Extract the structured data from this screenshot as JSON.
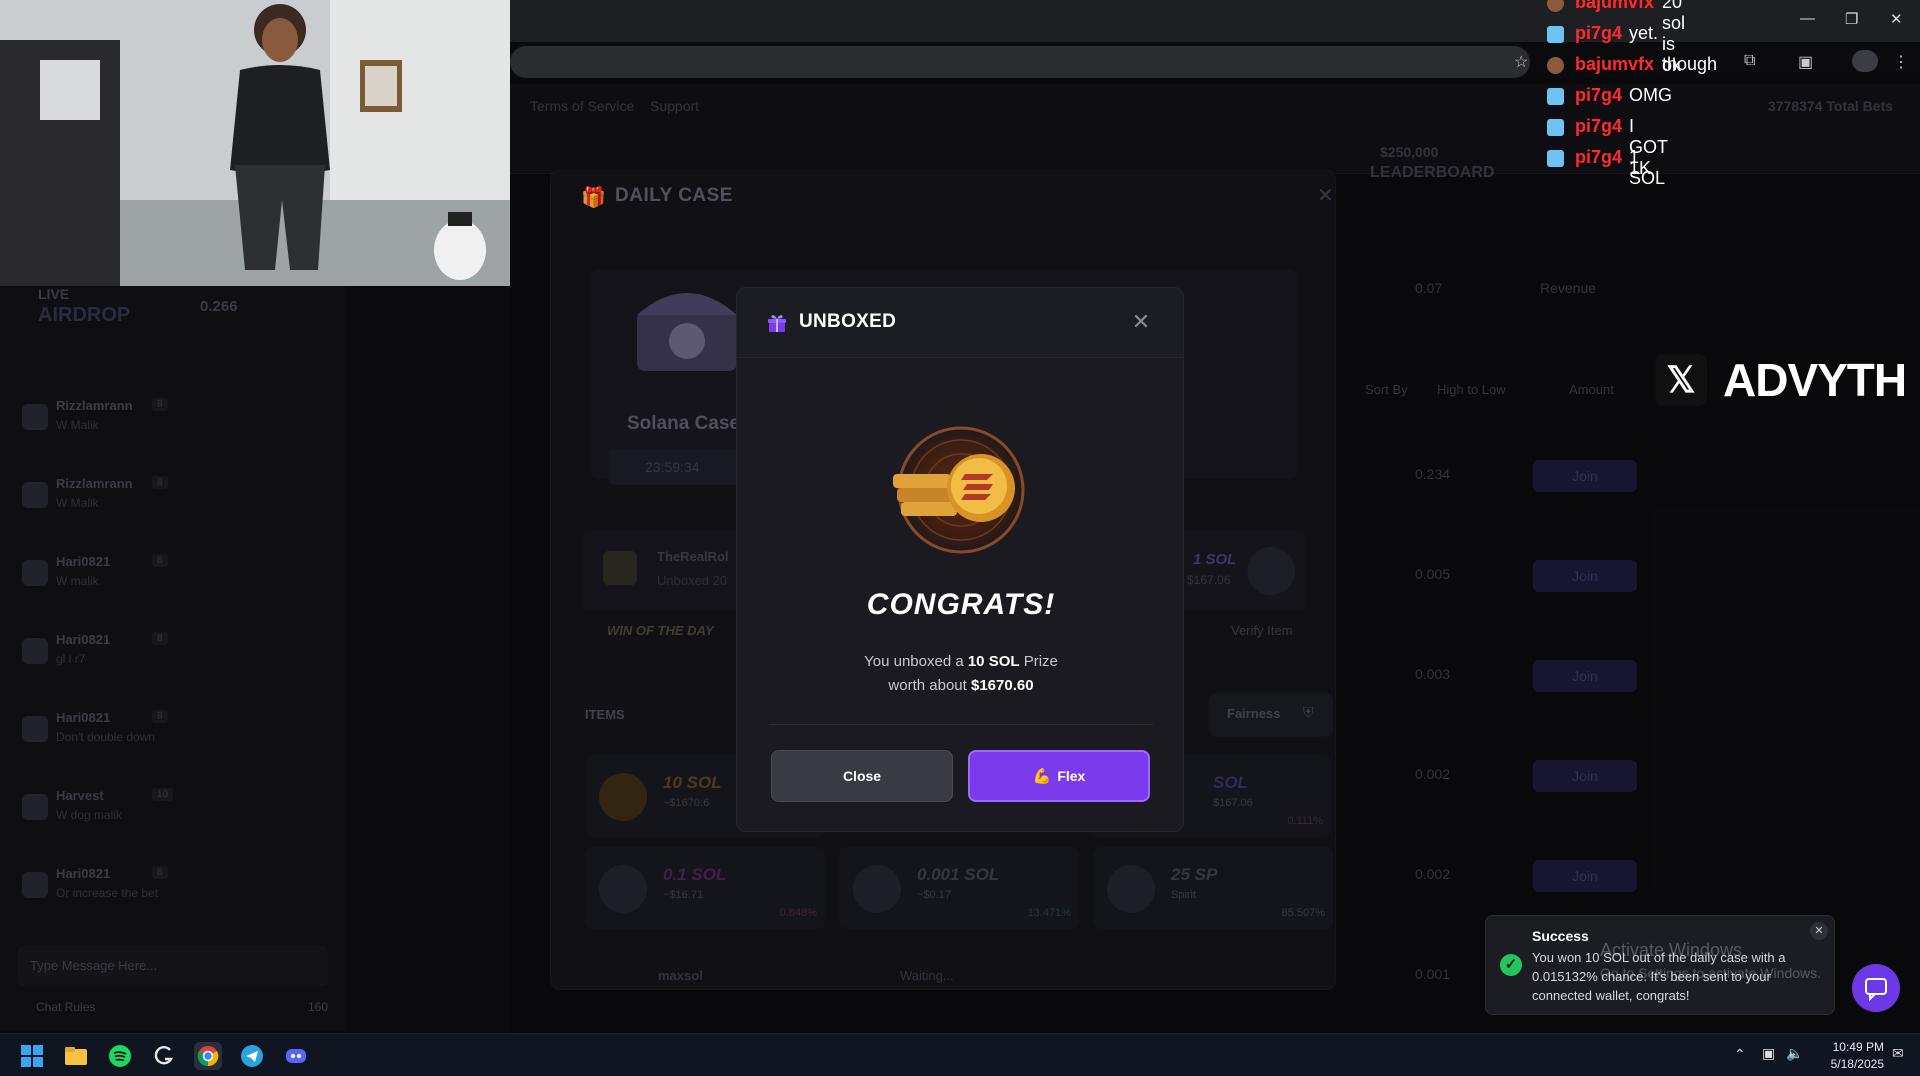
{
  "stream_chat": [
    {
      "name": "bajumvfx",
      "message": "20 sol is ok"
    },
    {
      "name": "pi7g4",
      "message": "yet."
    },
    {
      "name": "bajumvfx",
      "message": "though"
    },
    {
      "name": "pi7g4",
      "message": "OMG"
    },
    {
      "name": "pi7g4",
      "message": "I GOT 1K"
    },
    {
      "name": "pi7g4",
      "message": "1 SOL"
    }
  ],
  "overlay_brand": "ADVYTH",
  "site": {
    "nav": [
      "Fairness",
      "Terms of Service",
      "Support"
    ],
    "total_bets": "3778374 Total Bets",
    "leaderboard_amount": "$250,000",
    "leaderboard_label": "LEADERBOARD",
    "live_label": "LIVE",
    "airdrop_label": "AIRDROP",
    "balance": "0.266"
  },
  "left_chat": [
    {
      "name": "Rizzlamrann",
      "level": "8",
      "message": "W Malik"
    },
    {
      "name": "Rizzlamrann",
      "level": "8",
      "message": "W Malik"
    },
    {
      "name": "Hari0821",
      "level": "8",
      "message": "W malik"
    },
    {
      "name": "Hari0821",
      "level": "8",
      "message": "gl l r7"
    },
    {
      "name": "Hari0821",
      "level": "8",
      "message": "Don't double down"
    },
    {
      "name": "Harvest",
      "level": "10",
      "message": "W dog malik"
    },
    {
      "name": "Hari0821",
      "level": "8",
      "message": "Or increase the bet"
    }
  ],
  "chat_input": {
    "placeholder": "Type Message Here...",
    "rules": "Chat Rules",
    "online": "160"
  },
  "daily_case": {
    "title": "DAILY CASE",
    "case_name": "Solana Case",
    "timer": "23:59:34",
    "recent_user": "TheRealRol",
    "recent_text": "Unboxed 20",
    "recent_prize": "1 SOL",
    "recent_value": "$167.06",
    "win_of_day": "WIN OF THE DAY",
    "verify_item": "Verify Item",
    "items_label": "ITEMS",
    "fairness_button": "Fairness",
    "items": [
      {
        "name": "10 SOL",
        "sub": "~$1670.6",
        "pct": "",
        "color": "#c0842c"
      },
      {
        "name": "SOL",
        "sub": "$167.06",
        "pct": "0.111%",
        "color": "#9b5cf0"
      },
      {
        "name": "0.1 SOL",
        "sub": "~$16.71",
        "pct": "0.848%",
        "color": "#b03cc7"
      },
      {
        "name": "0.001 SOL",
        "sub": "~$0.17",
        "pct": "13.471%",
        "color": "#6e6e80"
      },
      {
        "name": "25 SP",
        "sub": "Spirit",
        "pct": "85.507%",
        "color": "#6e6e80"
      }
    ]
  },
  "bets": {
    "headers": {
      "sort_by": "Sort By",
      "sort_value": "High to Low",
      "amount": "Amount"
    },
    "top_amount": "0.07",
    "top_label": "Revenue",
    "rows": [
      {
        "amount": "0.234",
        "action": "Join"
      },
      {
        "amount": "0.005",
        "action": "Join"
      },
      {
        "amount": "0.003",
        "action": "Join"
      },
      {
        "amount": "0.002",
        "action": "Join"
      },
      {
        "amount": "0.002",
        "action": "Join"
      },
      {
        "amount": "0.001",
        "action": ""
      }
    ],
    "footer_user": "maxsol",
    "footer_status": "Waiting..."
  },
  "unboxed_modal": {
    "title": "UNBOXED",
    "congrats": "CONGRATS!",
    "line1_pre": "You unboxed a ",
    "line1_bold": "10 SOL",
    "line1_post": " Prize",
    "line2_pre": "worth about ",
    "line2_bold": "$1670.60",
    "close_label": "Close",
    "flex_label": "Flex"
  },
  "toast": {
    "title": "Success",
    "body": "You won 10 SOL out of the daily case with a 0.015132% chance. It's been sent to your connected wallet, congrats!"
  },
  "windows_watermark": {
    "line1": "Activate Windows",
    "line2": "Go to Settings to activate Windows."
  },
  "taskbar": {
    "time": "10:49 PM",
    "date": "5/18/2025"
  }
}
